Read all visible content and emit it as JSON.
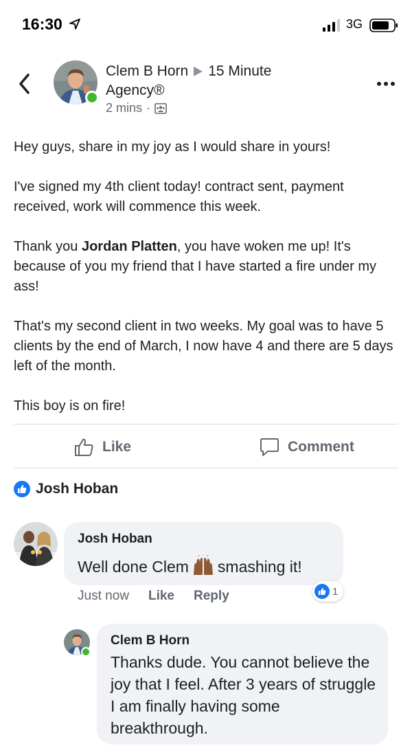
{
  "status_bar": {
    "time": "16:30",
    "network": "3G"
  },
  "post": {
    "author": "Clem B Horn",
    "group": "15 Minute Agency®",
    "time_ago": "2 mins",
    "separator": "·",
    "paragraphs": [
      {
        "text": "Hey guys, share in my joy as I would share in yours!"
      },
      {
        "text": "I've signed my 4th client today! contract sent, payment received, work will commence this week."
      },
      {
        "pre": "Thank you ",
        "mention": "Jordan Platten",
        "post": ", you have woken me up! It's because of you my friend that I have started a fire under my ass!"
      },
      {
        "text": "That's my second client in two weeks. My goal was to have 5 clients by the end of March, I now have 4 and there are 5 days left of the month."
      },
      {
        "text": "This boy is on fire!"
      }
    ]
  },
  "actions": {
    "like_label": "Like",
    "comment_label": "Comment"
  },
  "reactions": {
    "reactor_name": "Josh Hoban"
  },
  "comments": [
    {
      "author": "Josh Hoban",
      "text_before": "Well done Clem",
      "emoji_icon": "raising-hands-icon",
      "text_after": "smashing it!",
      "time": "Just now",
      "like_label": "Like",
      "reply_label": "Reply",
      "reaction_count": "1"
    },
    {
      "author": "Clem B Horn",
      "text": "Thanks dude. You cannot believe the joy that I feel. After 3 years of struggle I am finally having some breakthrough."
    }
  ],
  "colors": {
    "facebook_blue": "#1877f2",
    "online_green": "#42b72a",
    "secondary_text": "#606770",
    "bubble_bg": "#f0f2f5"
  }
}
